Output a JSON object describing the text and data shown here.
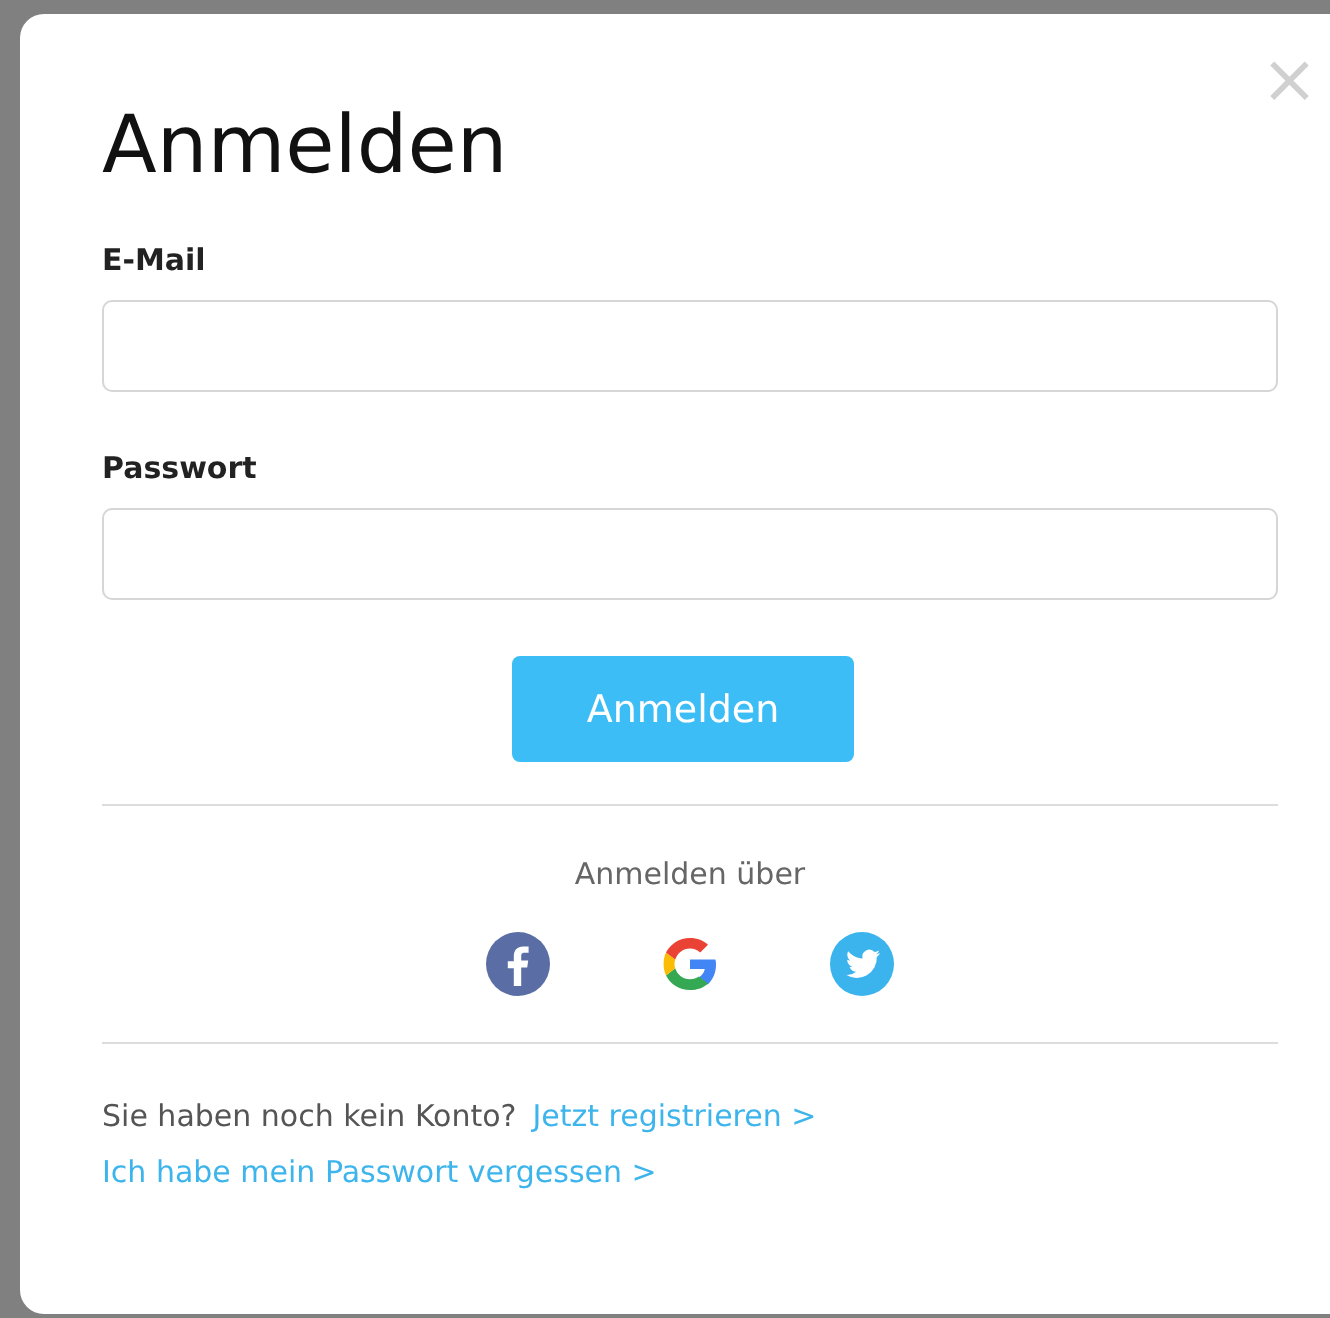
{
  "dialog": {
    "close": "×",
    "title": "Anmelden",
    "fields": [
      {
        "label": "E-Mail"
      },
      {
        "label": "Passwort"
      }
    ],
    "submit": "Anmelden",
    "social": {
      "label": "Anmelden über",
      "providers": [
        {
          "kind": "facebook"
        },
        {
          "kind": "google"
        },
        {
          "kind": "twitter"
        }
      ]
    },
    "register": {
      "question": "Sie haben noch kein Konto?",
      "link": "Jetzt registrieren >"
    },
    "forgot": "Ich habe mein Passwort vergessen >"
  }
}
